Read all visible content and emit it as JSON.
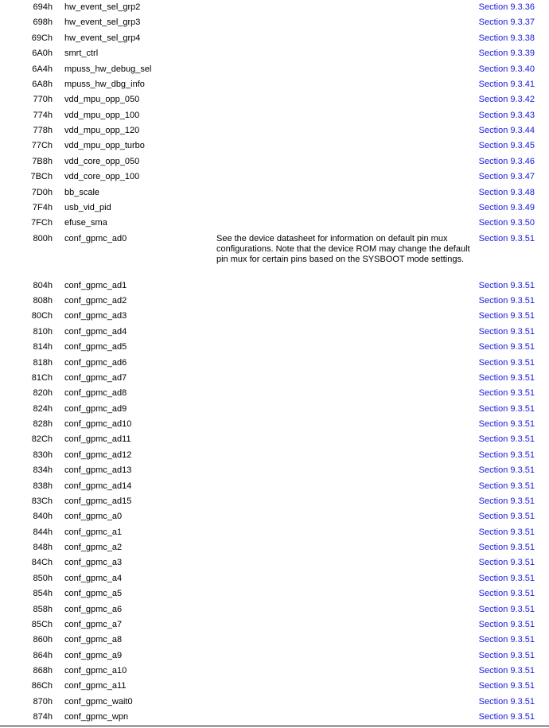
{
  "rows": [
    {
      "offset": "694h",
      "acronym": "hw_event_sel_grp2",
      "description": "",
      "section": "Section 9.3.36"
    },
    {
      "offset": "698h",
      "acronym": "hw_event_sel_grp3",
      "description": "",
      "section": "Section 9.3.37"
    },
    {
      "offset": "69Ch",
      "acronym": "hw_event_sel_grp4",
      "description": "",
      "section": "Section 9.3.38"
    },
    {
      "offset": "6A0h",
      "acronym": "smrt_ctrl",
      "description": "",
      "section": "Section 9.3.39"
    },
    {
      "offset": "6A4h",
      "acronym": "mpuss_hw_debug_sel",
      "description": "",
      "section": "Section 9.3.40"
    },
    {
      "offset": "6A8h",
      "acronym": "mpuss_hw_dbg_info",
      "description": "",
      "section": "Section 9.3.41"
    },
    {
      "offset": "770h",
      "acronym": "vdd_mpu_opp_050",
      "description": "",
      "section": "Section 9.3.42"
    },
    {
      "offset": "774h",
      "acronym": "vdd_mpu_opp_100",
      "description": "",
      "section": "Section 9.3.43"
    },
    {
      "offset": "778h",
      "acronym": "vdd_mpu_opp_120",
      "description": "",
      "section": "Section 9.3.44"
    },
    {
      "offset": "77Ch",
      "acronym": "vdd_mpu_opp_turbo",
      "description": "",
      "section": "Section 9.3.45"
    },
    {
      "offset": "7B8h",
      "acronym": "vdd_core_opp_050",
      "description": "",
      "section": "Section 9.3.46"
    },
    {
      "offset": "7BCh",
      "acronym": "vdd_core_opp_100",
      "description": "",
      "section": "Section 9.3.47"
    },
    {
      "offset": "7D0h",
      "acronym": "bb_scale",
      "description": "",
      "section": "Section 9.3.48"
    },
    {
      "offset": "7F4h",
      "acronym": "usb_vid_pid",
      "description": "",
      "section": "Section 9.3.49"
    },
    {
      "offset": "7FCh",
      "acronym": "efuse_sma",
      "description": "",
      "section": "Section 9.3.50"
    },
    {
      "offset": "800h",
      "acronym": "conf_gpmc_ad0",
      "description": "See the device datasheet for information on default pin mux configurations. Note that the device ROM may change the default pin mux for certain pins based on the SYSBOOT mode settings.",
      "section": "Section 9.3.51"
    },
    {
      "offset": "804h",
      "acronym": "conf_gpmc_ad1",
      "description": "",
      "section": "Section 9.3.51"
    },
    {
      "offset": "808h",
      "acronym": "conf_gpmc_ad2",
      "description": "",
      "section": "Section 9.3.51"
    },
    {
      "offset": "80Ch",
      "acronym": "conf_gpmc_ad3",
      "description": "",
      "section": "Section 9.3.51"
    },
    {
      "offset": "810h",
      "acronym": "conf_gpmc_ad4",
      "description": "",
      "section": "Section 9.3.51"
    },
    {
      "offset": "814h",
      "acronym": "conf_gpmc_ad5",
      "description": "",
      "section": "Section 9.3.51"
    },
    {
      "offset": "818h",
      "acronym": "conf_gpmc_ad6",
      "description": "",
      "section": "Section 9.3.51"
    },
    {
      "offset": "81Ch",
      "acronym": "conf_gpmc_ad7",
      "description": "",
      "section": "Section 9.3.51"
    },
    {
      "offset": "820h",
      "acronym": "conf_gpmc_ad8",
      "description": "",
      "section": "Section 9.3.51"
    },
    {
      "offset": "824h",
      "acronym": "conf_gpmc_ad9",
      "description": "",
      "section": "Section 9.3.51"
    },
    {
      "offset": "828h",
      "acronym": "conf_gpmc_ad10",
      "description": "",
      "section": "Section 9.3.51"
    },
    {
      "offset": "82Ch",
      "acronym": "conf_gpmc_ad11",
      "description": "",
      "section": "Section 9.3.51"
    },
    {
      "offset": "830h",
      "acronym": "conf_gpmc_ad12",
      "description": "",
      "section": "Section 9.3.51"
    },
    {
      "offset": "834h",
      "acronym": "conf_gpmc_ad13",
      "description": "",
      "section": "Section 9.3.51"
    },
    {
      "offset": "838h",
      "acronym": "conf_gpmc_ad14",
      "description": "",
      "section": "Section 9.3.51"
    },
    {
      "offset": "83Ch",
      "acronym": "conf_gpmc_ad15",
      "description": "",
      "section": "Section 9.3.51"
    },
    {
      "offset": "840h",
      "acronym": "conf_gpmc_a0",
      "description": "",
      "section": "Section 9.3.51"
    },
    {
      "offset": "844h",
      "acronym": "conf_gpmc_a1",
      "description": "",
      "section": "Section 9.3.51"
    },
    {
      "offset": "848h",
      "acronym": "conf_gpmc_a2",
      "description": "",
      "section": "Section 9.3.51"
    },
    {
      "offset": "84Ch",
      "acronym": "conf_gpmc_a3",
      "description": "",
      "section": "Section 9.3.51"
    },
    {
      "offset": "850h",
      "acronym": "conf_gpmc_a4",
      "description": "",
      "section": "Section 9.3.51"
    },
    {
      "offset": "854h",
      "acronym": "conf_gpmc_a5",
      "description": "",
      "section": "Section 9.3.51"
    },
    {
      "offset": "858h",
      "acronym": "conf_gpmc_a6",
      "description": "",
      "section": "Section 9.3.51"
    },
    {
      "offset": "85Ch",
      "acronym": "conf_gpmc_a7",
      "description": "",
      "section": "Section 9.3.51"
    },
    {
      "offset": "860h",
      "acronym": "conf_gpmc_a8",
      "description": "",
      "section": "Section 9.3.51"
    },
    {
      "offset": "864h",
      "acronym": "conf_gpmc_a9",
      "description": "",
      "section": "Section 9.3.51"
    },
    {
      "offset": "868h",
      "acronym": "conf_gpmc_a10",
      "description": "",
      "section": "Section 9.3.51"
    },
    {
      "offset": "86Ch",
      "acronym": "conf_gpmc_a11",
      "description": "",
      "section": "Section 9.3.51"
    },
    {
      "offset": "870h",
      "acronym": "conf_gpmc_wait0",
      "description": "",
      "section": "Section 9.3.51"
    },
    {
      "offset": "874h",
      "acronym": "conf_gpmc_wpn",
      "description": "",
      "section": "Section 9.3.51"
    }
  ],
  "colors": {
    "link": "#1a1adc",
    "text": "#000000"
  }
}
